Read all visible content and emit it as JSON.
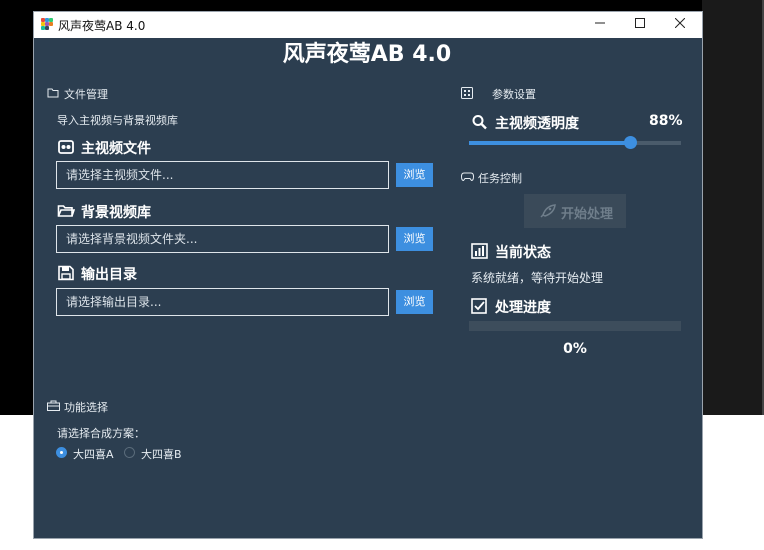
{
  "window": {
    "title": "风声夜莺AB 4.0"
  },
  "header": {
    "title": "风声夜莺AB 4.0"
  },
  "file_section": {
    "label": "文件管理",
    "hint": "导入主视频与背景视频库",
    "main_video": {
      "heading": "主视频文件",
      "placeholder": "请选择主视频文件...",
      "browse": "浏览"
    },
    "bg_library": {
      "heading": "背景视频库",
      "placeholder": "请选择背景视频文件夹...",
      "browse": "浏览"
    },
    "output_dir": {
      "heading": "输出目录",
      "placeholder": "请选择输出目录...",
      "browse": "浏览"
    }
  },
  "params": {
    "label": "参数设置",
    "opacity_label": "主视频透明度",
    "opacity_value": "88%",
    "opacity_level": 0.76
  },
  "task": {
    "label": "任务控制",
    "start_button": "开始处理"
  },
  "status": {
    "heading": "当前状态",
    "text": "系统就绪，等待开始处理"
  },
  "progress": {
    "heading": "处理进度",
    "text": "0%",
    "level": 0
  },
  "function_section": {
    "label": "功能选择",
    "prompt": "请选择合成方案：",
    "options": [
      {
        "label": "大四喜A",
        "selected": true
      },
      {
        "label": "大四喜B",
        "selected": false
      }
    ]
  },
  "colors": {
    "accent": "#3d8fe0",
    "background": "#2c3e50"
  }
}
